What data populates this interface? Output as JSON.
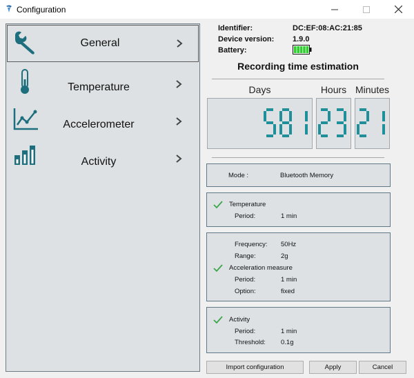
{
  "window": {
    "title": "Configuration"
  },
  "nav": [
    {
      "label": "General",
      "icon": "wrench-icon"
    },
    {
      "label": "Temperature",
      "icon": "thermometer-icon"
    },
    {
      "label": "Accelerometer",
      "icon": "line-chart-icon"
    },
    {
      "label": "Activity",
      "icon": "bar-chart-icon"
    }
  ],
  "device": {
    "identifier_label": "Identifier:",
    "identifier_value": "DC:EF:08:AC:21:85",
    "version_label": "Device version:",
    "version_value": "1.9.0",
    "battery_label": "Battery:",
    "battery_level": 1.0
  },
  "recording": {
    "title": "Recording time estimation",
    "days_label": "Days",
    "hours_label": "Hours",
    "minutes_label": "Minutes",
    "days_value": "581",
    "hours_value": "23",
    "minutes_value": "21"
  },
  "mode": {
    "label": "Mode :",
    "value": "Bluetooth Memory"
  },
  "temperature": {
    "title": "Temperature",
    "period_label": "Period:",
    "period_value": "1 min",
    "enabled": true
  },
  "acceleration": {
    "frequency_label": "Frequency:",
    "frequency_value": "50Hz",
    "range_label": "Range:",
    "range_value": "2g",
    "title": "Acceleration measure",
    "period_label": "Period:",
    "period_value": "1 min",
    "option_label": "Option:",
    "option_value": "fixed",
    "enabled": true
  },
  "activity": {
    "title": "Activity",
    "period_label": "Period:",
    "period_value": "1 min",
    "threshold_label": "Threshold:",
    "threshold_value": "0.1g",
    "enabled": true
  },
  "buttons": {
    "import": "Import configuration",
    "apply": "Apply",
    "cancel": "Cancel"
  },
  "colors": {
    "accent": "#1f7f8c",
    "lcd_digit": "#1f8f99",
    "check": "#3aa64a",
    "battery": "#2fcf2f"
  }
}
